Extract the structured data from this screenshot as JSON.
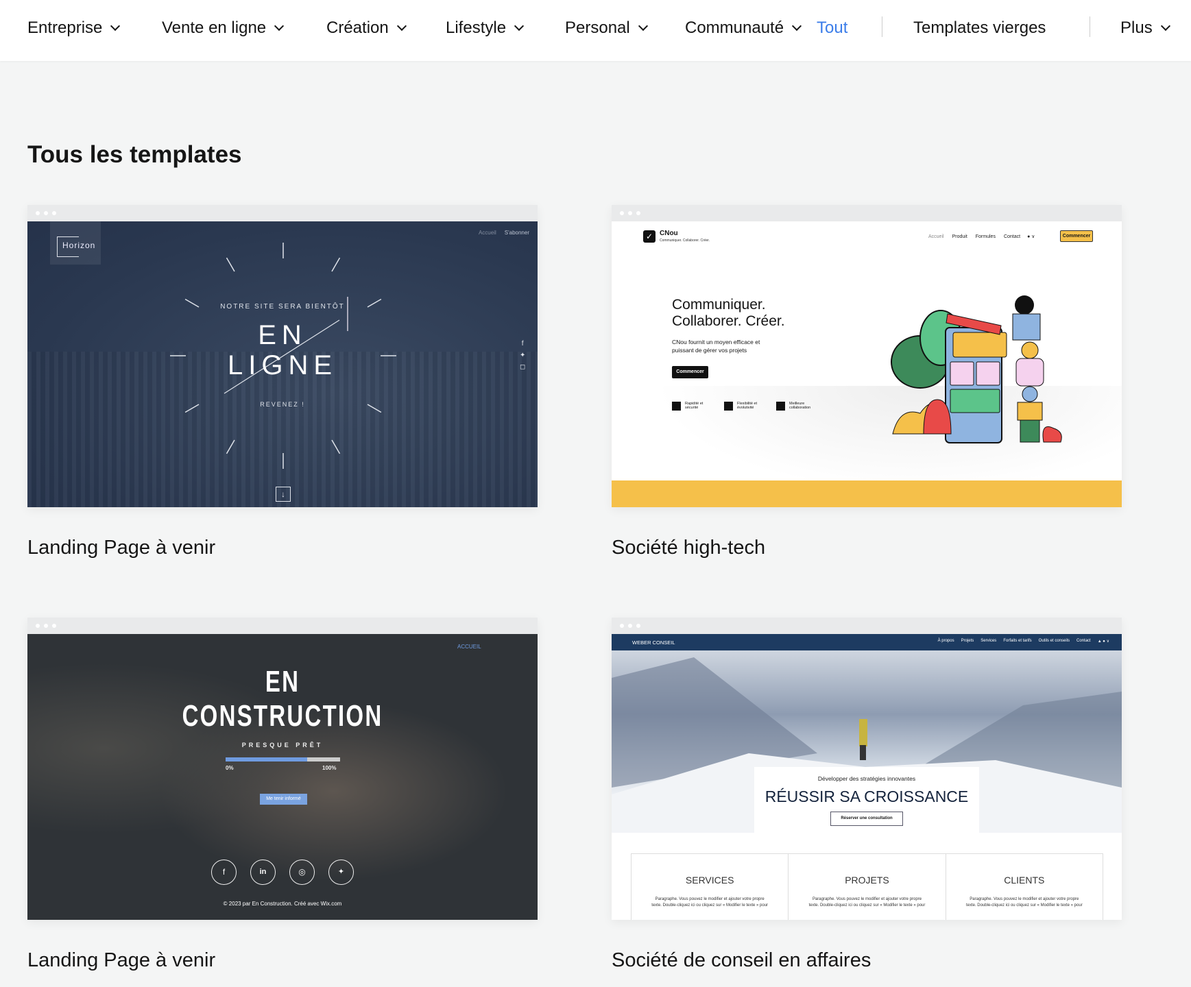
{
  "nav": {
    "items": [
      {
        "label": "Entreprise",
        "dropdown": true
      },
      {
        "label": "Vente en ligne",
        "dropdown": true
      },
      {
        "label": "Création",
        "dropdown": true
      },
      {
        "label": "Lifestyle",
        "dropdown": true
      },
      {
        "label": "Personal",
        "dropdown": true
      },
      {
        "label": "Communauté",
        "dropdown": true
      },
      {
        "label": "Tout",
        "active": true
      },
      {
        "label": "Templates vierges"
      },
      {
        "label": "Plus",
        "dropdown": true
      }
    ],
    "active_color": "#3b7de9"
  },
  "page_title": "Tous les templates",
  "templates": [
    {
      "name": "Landing Page à venir",
      "preview": {
        "logo": "Horizon",
        "nav": [
          "Accueil",
          "S'abonner"
        ],
        "kicker": "NOTRE SITE SERA BIENTÔT",
        "line1": "EN",
        "line2": "LIGNE",
        "sub": "REVENEZ !",
        "social": [
          "facebook-icon",
          "twitter-icon",
          "instagram-icon"
        ]
      }
    },
    {
      "name": "Société high-tech",
      "preview": {
        "brand": "CNou",
        "tagline": "Communiquer. Collaborer. Créer.",
        "nav": [
          "Accueil",
          "Produit",
          "Formules",
          "Contact"
        ],
        "cta": "Commencer",
        "heading1": "Communiquer.",
        "heading2": "Collaborer. Créer.",
        "para": "CNou fournit un moyen efficace et puissant de gérer vos projets",
        "button": "Commencer",
        "features": [
          "Rapidité et sécurité",
          "Flexibilité et évolutivité",
          "Meilleure collaboration"
        ],
        "accent": "#f5c04a"
      }
    },
    {
      "name": "Landing Page à venir",
      "preview": {
        "nav": "ACCUEIL",
        "line1": "EN",
        "line2": "CONSTRUCTION",
        "sub": "PRESQUE PRÊT",
        "progress_percent": 71,
        "min_label": "0%",
        "max_label": "100%",
        "button": "Me tenir informé",
        "social": [
          "facebook-icon",
          "linkedin-icon",
          "instagram-icon",
          "twitter-icon"
        ],
        "footer": "© 2023 par En Construction. Créé avec Wix.com"
      }
    },
    {
      "name": "Société de conseil en affaires",
      "preview": {
        "brand": "WEBER CONSEIL",
        "nav": [
          "À propos",
          "Projets",
          "Services",
          "Forfaits et tarifs",
          "Outils et conseils",
          "Contact"
        ],
        "kicker": "Développer des stratégies innovantes",
        "heading": "RÉUSSIR SA CROISSANCE",
        "button": "Réserver une consultation",
        "columns": [
          "SERVICES",
          "PROJETS",
          "CLIENTS"
        ],
        "para": "Paragraphe. Vous pouvez le modifier et ajouter votre propre texte. Double-cliquez ici ou cliquez sur « Modifier le texte » pour"
      }
    }
  ]
}
